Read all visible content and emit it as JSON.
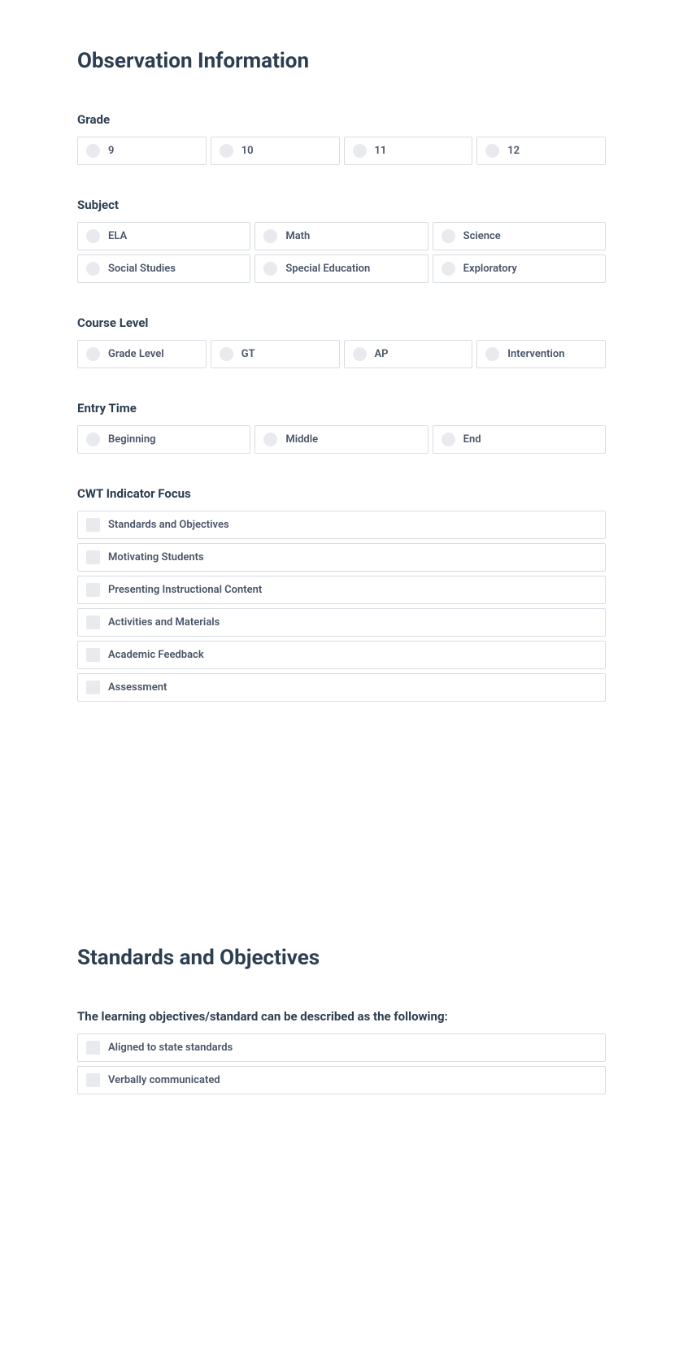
{
  "section1": {
    "title": "Observation Information",
    "grade": {
      "label": "Grade",
      "options": [
        "9",
        "10",
        "11",
        "12"
      ]
    },
    "subject": {
      "label": "Subject",
      "options": [
        "ELA",
        "Math",
        "Science",
        "Social Studies",
        "Special Education",
        "Exploratory"
      ]
    },
    "course_level": {
      "label": "Course Level",
      "options": [
        "Grade Level",
        "GT",
        "AP",
        "Intervention"
      ]
    },
    "entry_time": {
      "label": "Entry Time",
      "options": [
        "Beginning",
        "Middle",
        "End"
      ]
    },
    "cwt_focus": {
      "label": "CWT Indicator Focus",
      "options": [
        "Standards and Objectives",
        "Motivating Students",
        "Presenting Instructional Content",
        "Activities and Materials",
        "Academic Feedback",
        "Assessment"
      ]
    }
  },
  "section2": {
    "title": "Standards and Objectives",
    "objectives": {
      "label": "The learning objectives/standard can be described as the following:",
      "options": [
        "Aligned to state standards",
        "Verbally communicated"
      ]
    }
  }
}
